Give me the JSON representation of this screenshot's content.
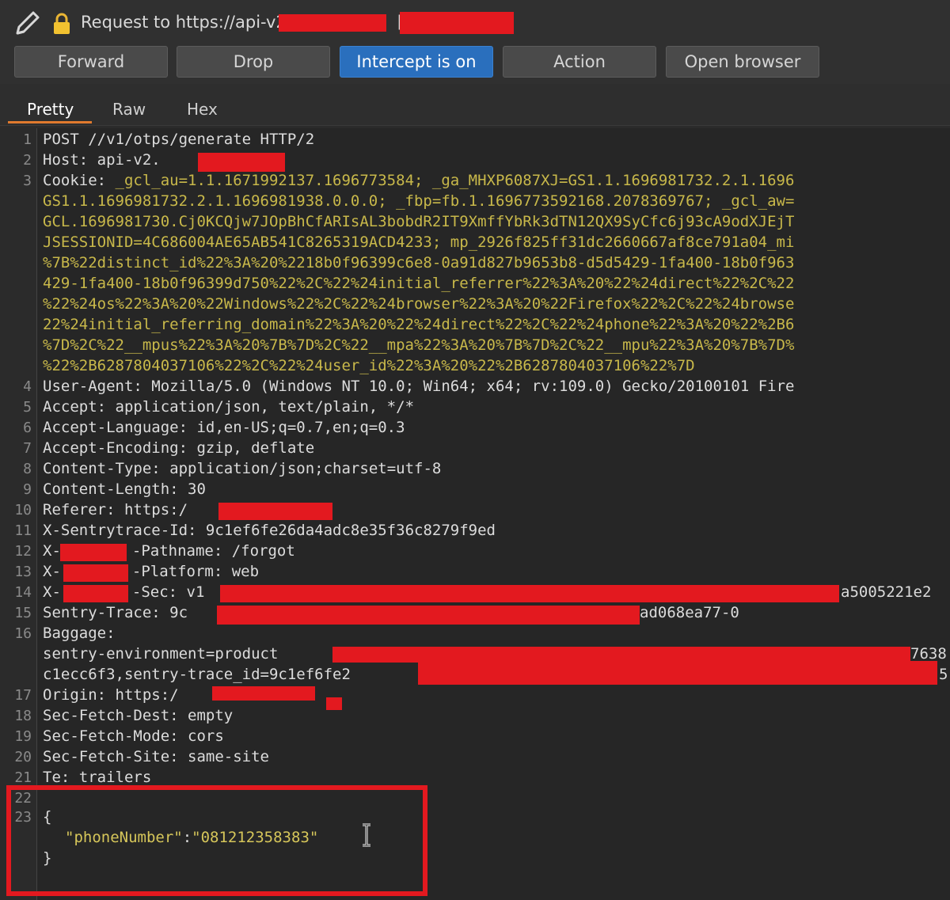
{
  "title": {
    "prefix": "Request to https://api-v2",
    "bracket": "["
  },
  "toolbar": {
    "forward": "Forward",
    "drop": "Drop",
    "intercept": "Intercept is on",
    "action": "Action",
    "open_browser": "Open browser"
  },
  "tabs": {
    "pretty": "Pretty",
    "raw": "Raw",
    "hex": "Hex"
  },
  "line_numbers": [
    "1",
    "2",
    "3",
    "4",
    "5",
    "6",
    "7",
    "8",
    "9",
    "10",
    "11",
    "12",
    "13",
    "14",
    "15",
    "16",
    "17",
    "18",
    "19",
    "20",
    "21",
    "22",
    "23"
  ],
  "lines": {
    "l1": "POST //v1/otps/generate HTTP/2",
    "l2_key": "Host: ",
    "l2_val": "api-v2.",
    "l3_key": "Cookie: ",
    "l3_val": "_gcl_au=1.1.1671992137.1696773584; _ga_MHXP6087XJ=GS1.1.1696981732.2.1.1696",
    "c1": "GS1.1.1696981732.2.1.1696981938.0.0.0; _fbp=fb.1.1696773592168.2078369767; _gcl_aw=",
    "c2": "GCL.1696981730.Cj0KCQjw7JOpBhCfARIsAL3bobdR2IT9XmffYbRk3dTN12QX9SyCfc6j93cA9odXJEjT",
    "c3": "JSESSIONID=4C686004AE65AB541C8265319ACD4233; mp_2926f825ff31dc2660667af8ce791a04_mi",
    "c4": "%7B%22distinct_id%22%3A%20%2218b0f96399c6e8-0a91d827b9653b8-d5d5429-1fa400-18b0f963",
    "c5": "429-1fa400-18b0f96399d750%22%2C%22%24initial_referrer%22%3A%20%22%24direct%22%2C%22",
    "c6": "%22%24os%22%3A%20%22Windows%22%2C%22%24browser%22%3A%20%22Firefox%22%2C%22%24browse",
    "c7": "22%24initial_referring_domain%22%3A%20%22%24direct%22%2C%22%24phone%22%3A%20%22%2B6",
    "c8": "%7D%2C%22__mpus%22%3A%20%7B%7D%2C%22__mpa%22%3A%20%7B%7D%2C%22__mpu%22%3A%20%7B%7D%",
    "c9": "%22%2B6287804037106%22%2C%22%24user_id%22%3A%20%22%2B6287804037106%22%7D",
    "l4_key": "User-Agent: ",
    "l4_val": "Mozilla/5.0 (Windows NT 10.0; Win64; x64; rv:109.0) Gecko/20100101 Fire",
    "l5_key": "Accept: ",
    "l5_val": "application/json, text/plain, */*",
    "l6_key": "Accept-Language: ",
    "l6_val": "id,en-US;q=0.7,en;q=0.3",
    "l7_key": "Accept-Encoding: ",
    "l7_val": "gzip, deflate",
    "l8_key": "Content-Type: ",
    "l8_val": "application/json;charset=utf-8",
    "l9_key": "Content-Length: ",
    "l9_val": "30",
    "l10_key": "Referer: ",
    "l10_val": "https:/",
    "l11_key": "X-Sentrytrace-Id: ",
    "l11_val": "9c1ef6fe26da4adc8e35f36c8279f9ed",
    "l12_a": "X-",
    "l12_key": "-Pathname: ",
    "l12_val": "/forgot",
    "l13_a": "X-",
    "l13_key": "-Platform: ",
    "l13_val": "web",
    "l14_a": "X-",
    "l14_key": "-Sec: ",
    "l14_val": "v1",
    "l14_end": "a5005221e2",
    "l15_key": "Sentry-Trace: ",
    "l15_val": "9c",
    "l15_end": "ad068ea77-0",
    "l16_key": "Baggage:",
    "b1": "sentry-environment=product",
    "b1_end": "7638",
    "b2": "c1ecc6f3,sentry-trace_id=9c1ef6fe2",
    "b2_end": "5",
    "l17_key": "Origin: ",
    "l17_val": "https:/",
    "l18_key": "Sec-Fetch-Dest: ",
    "l18_val": "empty",
    "l19_key": "Sec-Fetch-Mode: ",
    "l19_val": "cors",
    "l20_key": "Sec-Fetch-Site: ",
    "l20_val": "same-site",
    "l21_key": "Te: ",
    "l21_val": "trailers",
    "l23_open": "{",
    "body_key": "\"phoneNumber\"",
    "body_colon": ":",
    "body_val": "\"081212358383\"",
    "close": "}"
  },
  "colors": {
    "redaction": "#e3191f",
    "intercept_on": "#2a6fbd",
    "tab_accent": "#e07a2e"
  }
}
